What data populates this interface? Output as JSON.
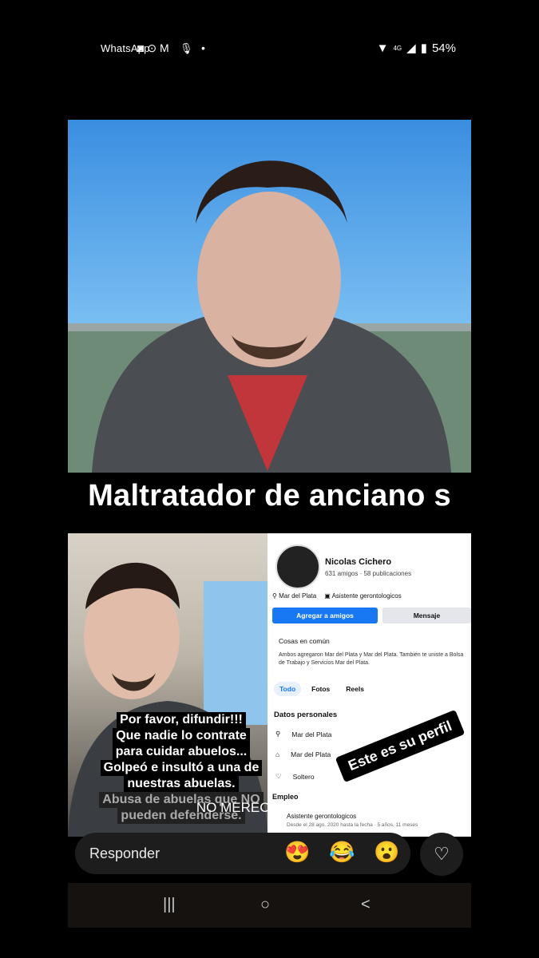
{
  "status_bar": {
    "app_label": "WhatsApp",
    "notif_icons": "◙ ⊙ M",
    "network": "4G",
    "battery": "54%"
  },
  "story": {
    "headline": "Maltratador de anciano s",
    "facebook_profile": {
      "name": "Nicolas Cichero",
      "counts": "631 amigos · 58 publicaciones",
      "location": "Mar del Plata",
      "job": "Asistente gerontologicos",
      "add_friend": "Agregar a amigos",
      "message": "Mensaje",
      "common_title": "Cosas en común",
      "common_body": "Ambos agregaron Mar del Plata y Mar del Plata. También te uniste a Bolsa de Trabajo y Servicios Mar del Plata.",
      "tabs": [
        "Todo",
        "Fotos",
        "Reels"
      ],
      "section_title": "Datos personales",
      "details": [
        "Mar del Plata",
        "Mar del Plata",
        "Soltero"
      ],
      "employment_title": "Empleo",
      "employment_job": "Asistente gerontologicos",
      "employment_since": "Desde el 28 ago. 2020 hasta la fecha · 5 años, 11 meses"
    },
    "plea_lines": [
      "Por favor, difundir!!!",
      "Que nadie lo contrate",
      "para cuidar abuelos...",
      "Golpeó e insultó a una de",
      "nuestras abuelas.",
      "Abusa de abuelas que NO",
      "pueden defenderse."
    ],
    "perfil_label": "Este es su perfil"
  },
  "caption": "NO MERECES LA VIDA",
  "reply_bar": {
    "placeholder": "Responder",
    "reactions": [
      "😍",
      "😂",
      "😮"
    ],
    "heart": "♡"
  },
  "navbar": {
    "recents": "|||",
    "home": "○",
    "back": "<"
  }
}
